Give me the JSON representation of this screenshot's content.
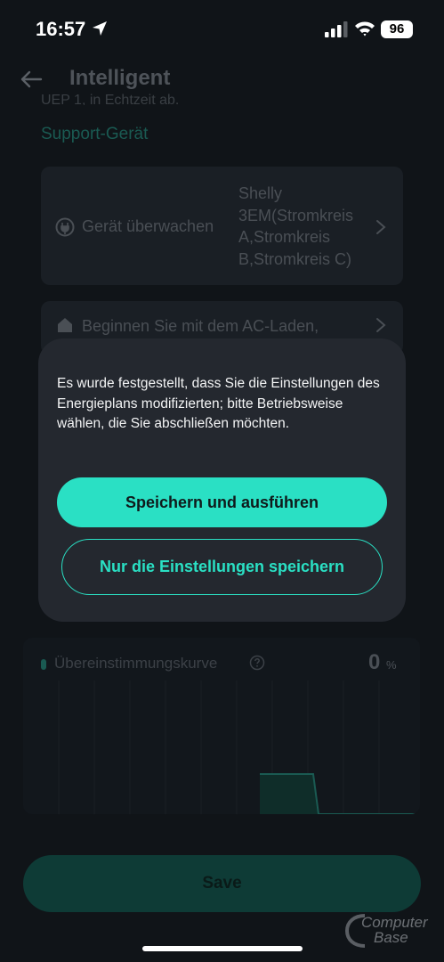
{
  "status_bar": {
    "time": "16:57",
    "battery": "96"
  },
  "header": {
    "title": "Intelligent"
  },
  "content": {
    "partial_text": "UEP 1, in Echtzeit ab.",
    "support_link": "Support-Gerät",
    "monitor_card": {
      "label": "Gerät überwachen",
      "value_lines": [
        "Shelly",
        "3EM(Stromkreis",
        "A,Stromkreis",
        "B,Stromkreis C)"
      ]
    },
    "ac_card": {
      "label": "Beginnen Sie mit dem AC-Laden,"
    },
    "chart": {
      "label": "Übereinstimmungskurve",
      "value": "0",
      "unit": "%"
    }
  },
  "dialog": {
    "message": "Es wurde festgestellt, dass Sie die Einstellungen des Energieplans modifizierten; bitte Betriebsweise wählen, die Sie abschließen möchten.",
    "primary_label": "Speichern und ausführen",
    "secondary_label": "Nur die Einstellungen speichern"
  },
  "footer": {
    "save_label": "Save"
  },
  "watermark": {
    "line1": "Computer",
    "line2": "Base"
  },
  "colors": {
    "accent": "#2ae0c4",
    "dialog_bg": "#24282f",
    "page_bg": "#101418"
  }
}
